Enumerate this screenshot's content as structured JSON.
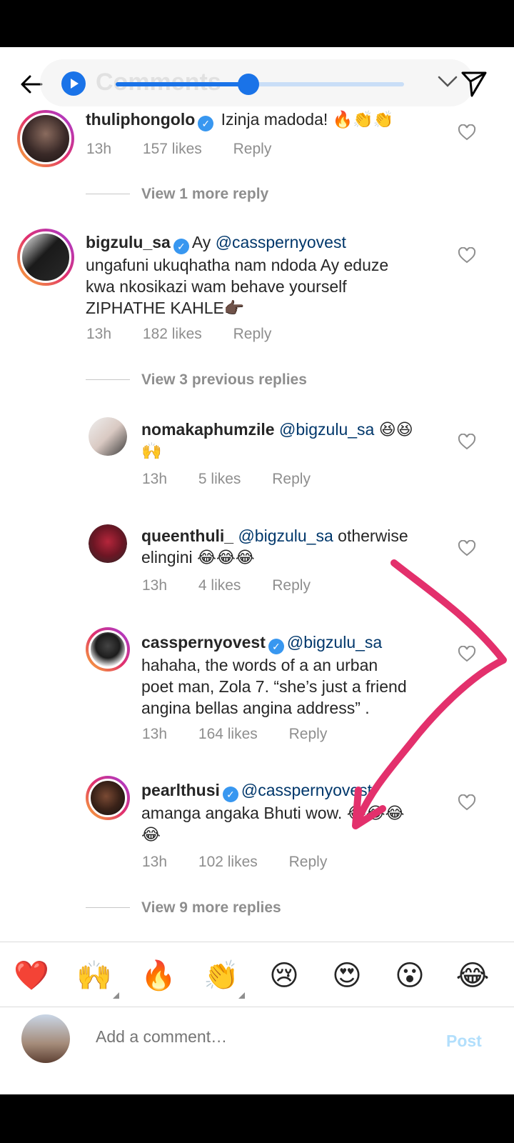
{
  "header": {
    "title": "Comments"
  },
  "audio_player": {
    "progress": 0.46
  },
  "comments": [
    {
      "username": "thuliphongolo",
      "verified": true,
      "text": "Izinja madoda! 🔥👏👏",
      "time": "13h",
      "likes": "157 likes",
      "reply": "Reply"
    },
    {
      "username": "bigzulu_sa",
      "verified": true,
      "prefix": "Ay",
      "mention": "@casspernyovest",
      "text_lines": [
        "ungafuni ukuqhatha nam ndoda Ay eduze",
        "kwa nkosikazi wam behave yourself",
        "ZIPHATHE KAHLE👉🏿"
      ],
      "time": "13h",
      "likes": "182 likes",
      "reply": "Reply"
    },
    {
      "username": "nomakaphumzile",
      "mention": "@bigzulu_sa",
      "text": "😆😆",
      "text2": "🙌",
      "time": "13h",
      "likes": "5 likes",
      "reply": "Reply"
    },
    {
      "username": "queenthuli_",
      "mention": "@bigzulu_sa",
      "text": "otherwise",
      "text2": "elingini 😂😂😂",
      "time": "13h",
      "likes": "4 likes",
      "reply": "Reply"
    },
    {
      "username": "casspernyovest",
      "verified": true,
      "mention": "@bigzulu_sa",
      "text_lines": [
        "hahaha, the words of a an urban",
        "poet man, Zola 7. “she’s just a friend",
        "angina bellas angina address” ."
      ],
      "time": "13h",
      "likes": "164 likes",
      "reply": "Reply"
    },
    {
      "username": "pearlthusi",
      "verified": true,
      "mention": "@casspernyovest",
      "text_lines": [
        "amanga angaka Bhuti wow. 😂😂😂",
        "😂"
      ],
      "time": "13h",
      "likes": "102 likes",
      "reply": "Reply"
    }
  ],
  "view_replies": {
    "first": "View 1 more reply",
    "previous": "View 3 previous replies",
    "more": "View 9 more replies"
  },
  "emoji_bar": [
    "❤️",
    "🙌",
    "🔥",
    "👏",
    "😢",
    "😍",
    "😮",
    "😂"
  ],
  "composer": {
    "placeholder": "Add a comment…",
    "post": "Post"
  },
  "colors": {
    "accent": "#1a73e8",
    "annotation": "#e3306c",
    "verified": "#3897f0",
    "mention": "#00376b"
  }
}
